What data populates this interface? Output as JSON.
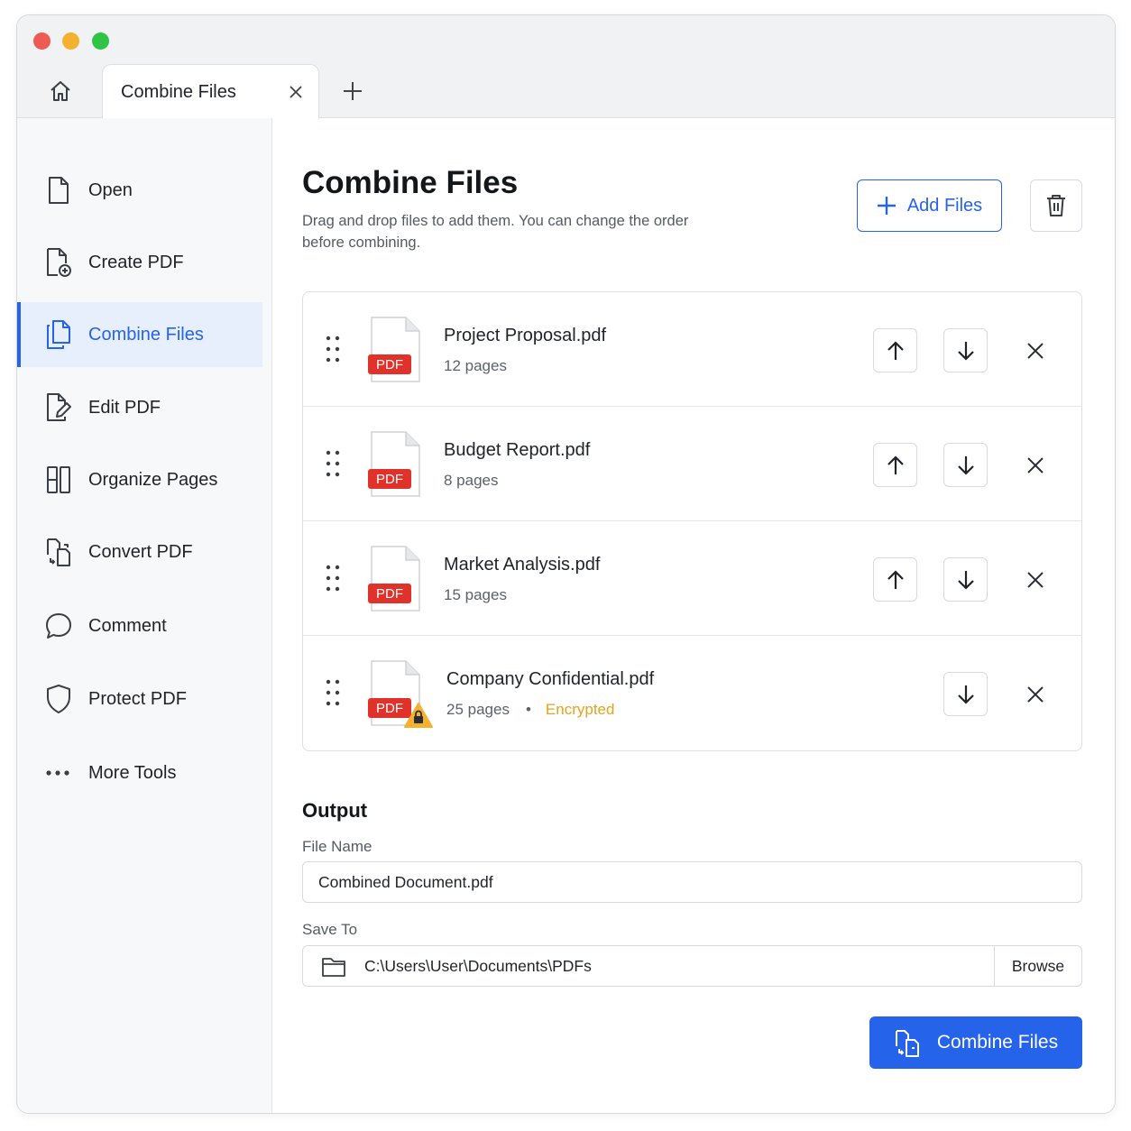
{
  "window": {
    "tab_title": "Combine Files"
  },
  "sidebar": {
    "items": [
      {
        "label": "Open",
        "icon": "file-icon"
      },
      {
        "label": "Create PDF",
        "icon": "file-plus-icon"
      },
      {
        "label": "Combine Files",
        "icon": "combine-files-icon",
        "active": true
      },
      {
        "label": "Edit PDF",
        "icon": "edit-file-icon"
      },
      {
        "label": "Organize Pages",
        "icon": "organize-pages-icon"
      },
      {
        "label": "Convert PDF",
        "icon": "convert-icon"
      },
      {
        "label": "Comment",
        "icon": "comment-icon"
      },
      {
        "label": "Protect PDF",
        "icon": "shield-icon"
      },
      {
        "label": "More Tools",
        "icon": "more-dots-icon"
      }
    ]
  },
  "main": {
    "title": "Combine Files",
    "subtitle": "Drag and drop files to add them. You can change the order before combining.",
    "add_files_label": "Add Files",
    "files": [
      {
        "name": "Project Proposal.pdf",
        "pages": "12 pages",
        "badge": "PDF"
      },
      {
        "name": "Budget Report.pdf",
        "pages": "8 pages",
        "badge": "PDF"
      },
      {
        "name": "Market Analysis.pdf",
        "pages": "15 pages",
        "badge": "PDF"
      },
      {
        "name": "Company Confidential.pdf",
        "pages": "25 pages",
        "badge": "PDF",
        "separator": "•",
        "status": "Encrypted"
      }
    ]
  },
  "output": {
    "title": "Output",
    "file_name_label": "File Name",
    "file_name_value": "Combined Document.pdf",
    "save_to_label": "Save To",
    "save_to_value": "C:\\Users\\User\\Documents\\PDFs",
    "browse_label": "Browse",
    "combine_label": "Combine Files"
  },
  "colors": {
    "accent": "#2563eb",
    "pdf_badge": "#e0322b",
    "encrypted": "#e3a41b"
  }
}
